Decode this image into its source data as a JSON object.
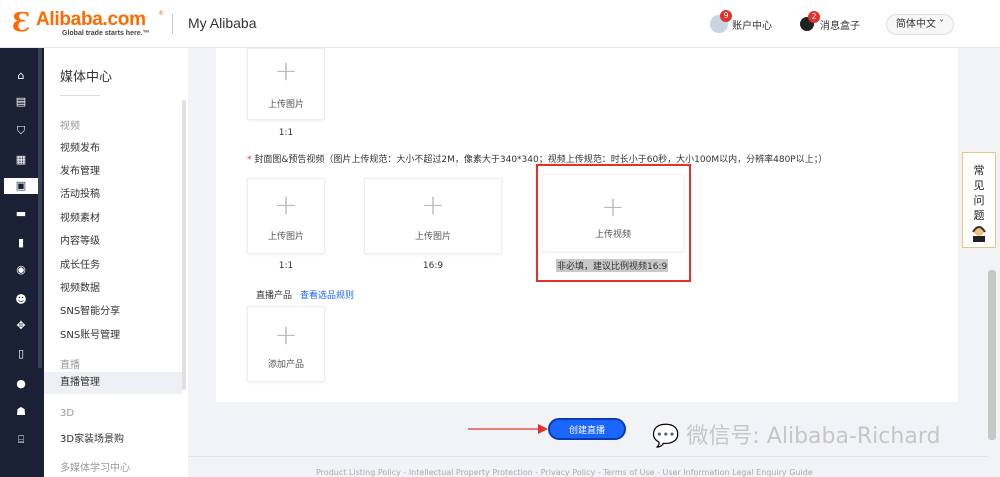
{
  "header": {
    "logo_mark": "Ɛ",
    "logo_text": "Alibaba.com",
    "logo_tm": "®",
    "logo_tagline": "Global trade starts here.™",
    "title": "My Alibaba",
    "account_badge": "9",
    "account_label": "账户中心",
    "message_badge": "2",
    "message_label": "消息盒子",
    "language": "简体中文 ˅"
  },
  "sidebar": {
    "title": "媒体中心",
    "groups": [
      {
        "label": "视频",
        "items": [
          "视频发布",
          "发布管理",
          "活动投稿",
          "视频素材",
          "内容等级",
          "成长任务",
          "视频数据",
          "SNS智能分享",
          "SNS账号管理"
        ]
      },
      {
        "label": "直播",
        "items": [
          "直播管理"
        ]
      },
      {
        "label": "3D",
        "items": [
          "3D家装场景购"
        ]
      },
      {
        "label": "多媒体学习中心",
        "items": []
      }
    ]
  },
  "main": {
    "top_upload": {
      "label": "上传图片",
      "ratio": "1:1"
    },
    "spec_star": "*",
    "spec_text": " 封面图&预告视频（图片上传规范：大小不超过2M，像素大于340*340；视频上传规范：时长小于60秒，大小100M以内，分辨率480P以上；）",
    "cover_uploads": [
      {
        "label": "上传图片",
        "ratio": "1:1"
      },
      {
        "label": "上传图片",
        "ratio": "16:9"
      },
      {
        "label": "上传视频",
        "ratio": "非必填，建议比例视频16:9"
      }
    ],
    "live_products_label": "直播产品",
    "view_rules_link": "查看选品规则",
    "add_product_label": "添加产品",
    "create_button": "创建直播"
  },
  "watermark": "💬 微信号: Alibaba-Richard",
  "footer": "Product Listing Policy - Intellectual Property Protection - Privacy Policy - Terms of Use - User Information Legal Enquiry Guide",
  "faq": [
    "常",
    "见",
    "问",
    "题"
  ],
  "colors": {
    "brand": "#ff6a00",
    "primary": "#1a66ff",
    "annotation_red": "#e3322b",
    "sidebar_dark": "#1b2135"
  }
}
